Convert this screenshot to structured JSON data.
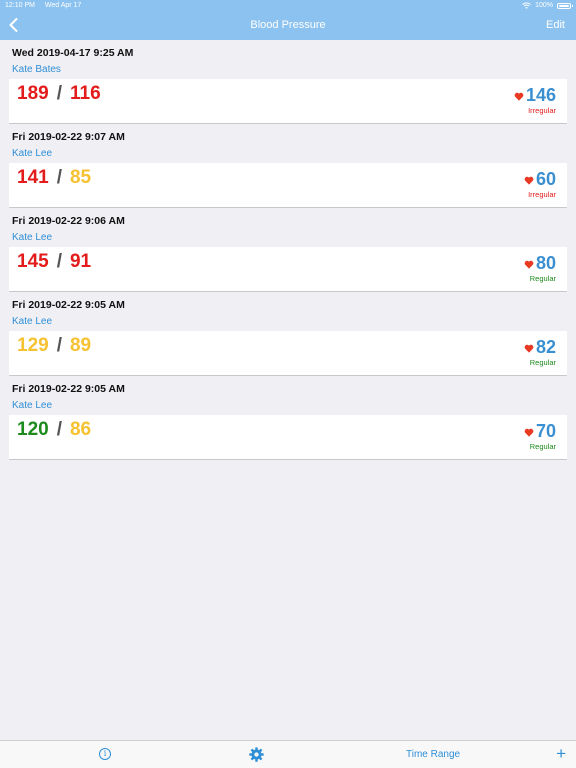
{
  "status_bar": {
    "time": "12:10 PM",
    "date": "Wed Apr 17",
    "battery": "100%"
  },
  "nav": {
    "title": "Blood Pressure",
    "edit_label": "Edit"
  },
  "readings": [
    {
      "date": "Wed 2019-04-17 9:25 AM",
      "name": "Kate Bates",
      "systolic": "189",
      "diastolic": "116",
      "systolic_color": "red",
      "diastolic_color": "red",
      "separator": "/",
      "pulse": "146",
      "rhythm": "Irregular"
    },
    {
      "date": "Fri 2019-02-22 9:07 AM",
      "name": "Kate Lee",
      "systolic": "141",
      "diastolic": "85",
      "systolic_color": "red",
      "diastolic_color": "yellow",
      "separator": "/",
      "pulse": "60",
      "rhythm": "Irregular"
    },
    {
      "date": "Fri 2019-02-22 9:06 AM",
      "name": "Kate Lee",
      "systolic": "145",
      "diastolic": "91",
      "systolic_color": "red",
      "diastolic_color": "red",
      "separator": "/",
      "pulse": "80",
      "rhythm": "Regular"
    },
    {
      "date": "Fri 2019-02-22 9:05 AM",
      "name": "Kate Lee",
      "systolic": "129",
      "diastolic": "89",
      "systolic_color": "yellow",
      "diastolic_color": "yellow",
      "separator": "/",
      "pulse": "82",
      "rhythm": "Regular"
    },
    {
      "date": "Fri 2019-02-22 9:05 AM",
      "name": "Kate Lee",
      "systolic": "120",
      "diastolic": "86",
      "systolic_color": "green",
      "diastolic_color": "yellow",
      "separator": "/",
      "pulse": "70",
      "rhythm": "Regular"
    }
  ],
  "tab_bar": {
    "info_label": "i",
    "time_range_label": "Time Range",
    "add_label": "+"
  },
  "colors": {
    "nav_bg": "#8cc2ef",
    "accent": "#2f8fd6",
    "red": "#e31b1b",
    "yellow": "#f6c232",
    "green": "#1c8a1c",
    "pulse": "#3a8fd0"
  },
  "icons": {
    "back": "chevron-left-icon",
    "heart": "heart-icon",
    "info": "info-icon",
    "settings": "gear-icon",
    "add": "plus-icon",
    "wifi": "wifi-icon",
    "battery": "battery-icon"
  }
}
